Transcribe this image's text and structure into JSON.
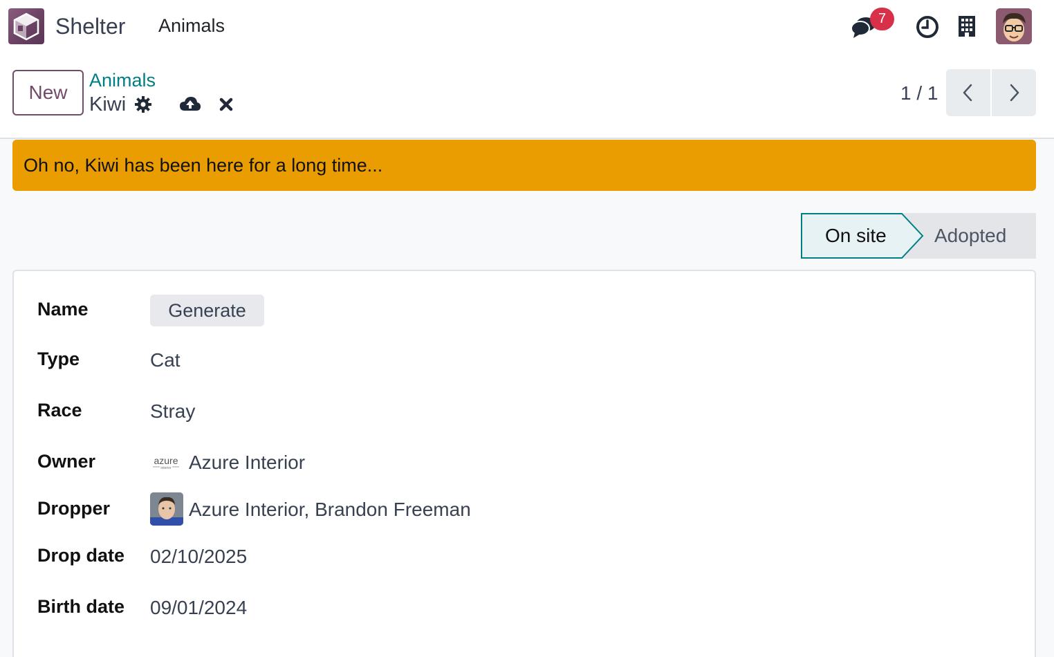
{
  "navbar": {
    "app_name": "Shelter",
    "menu_item": "Animals",
    "messages_badge": "7",
    "icons": [
      "app-logo-icon",
      "chat-icon",
      "clock-icon",
      "building-icon",
      "user-avatar"
    ]
  },
  "control_panel": {
    "new_label": "New",
    "breadcrumb": "Animals",
    "record_name": "Kiwi",
    "pager_value": "1 / 1",
    "icons": [
      "gear-icon",
      "cloud-upload-icon",
      "close-icon",
      "chevron-left-icon",
      "chevron-right-icon"
    ]
  },
  "alert": {
    "text": "Oh no, Kiwi has been here for a long time..."
  },
  "statusbar": {
    "stages": [
      "On site",
      "Adopted"
    ],
    "active_stage": "On site"
  },
  "form": {
    "name": {
      "label": "Name",
      "button": "Generate"
    },
    "type": {
      "label": "Type",
      "value": "Cat"
    },
    "race": {
      "label": "Race",
      "value": "Stray"
    },
    "owner": {
      "label": "Owner",
      "value": "Azure Interior",
      "logo_text": "azure",
      "logo_subtext": "interior"
    },
    "dropper": {
      "label": "Dropper",
      "value": "Azure Interior, Brandon Freeman"
    },
    "drop_date": {
      "label": "Drop date",
      "value": "02/10/2025"
    },
    "birth_date": {
      "label": "Birth date",
      "value": "09/01/2024"
    }
  },
  "colors": {
    "brand": "#714b67",
    "link": "#017e84",
    "warning": "#e99d00",
    "badge": "#d9304a",
    "stage_active_bg": "#e6f2f3",
    "stage_active_border": "#017e84"
  }
}
